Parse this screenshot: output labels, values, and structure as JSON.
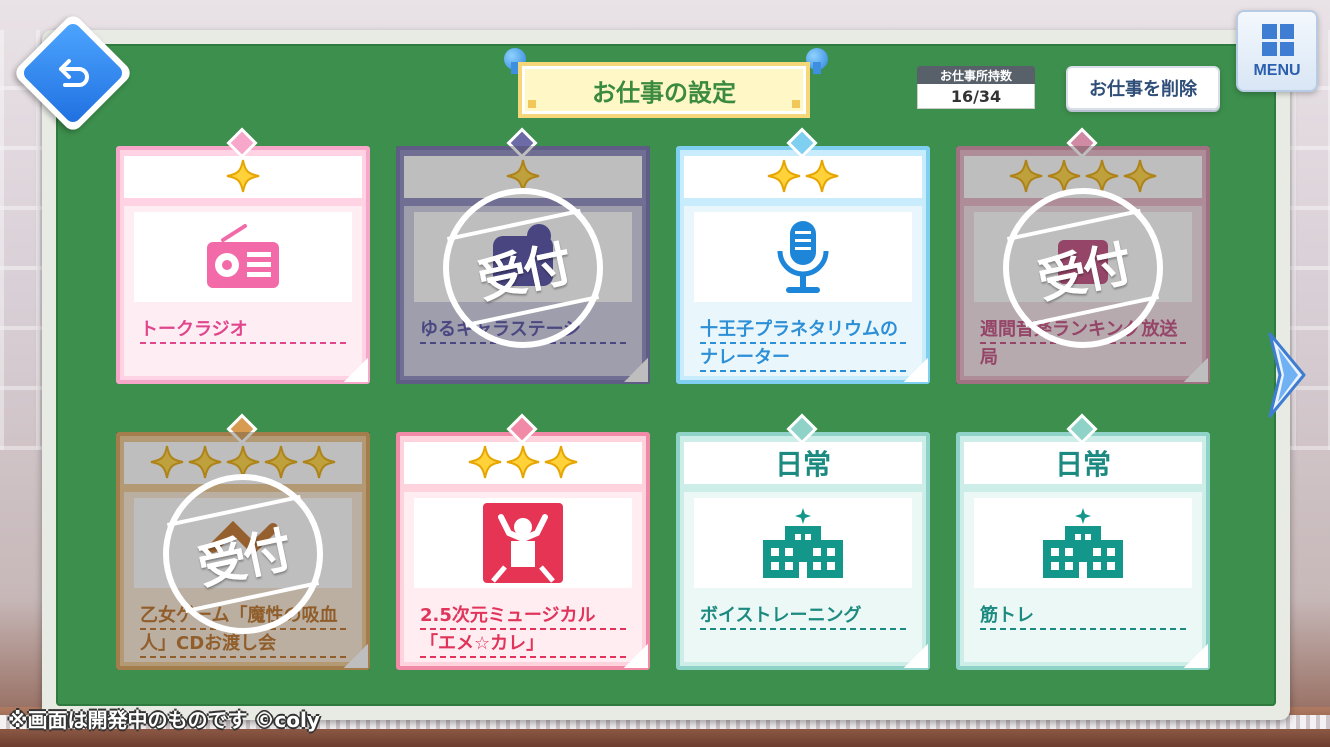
{
  "header": {
    "title": "お仕事の設定",
    "count_label": "お仕事所持数",
    "count_value": "16/34",
    "delete_label": "お仕事を削除",
    "menu_label": "MENU"
  },
  "jobs": [
    {
      "name": "トークラジオ",
      "stars": 1,
      "theme": "pink",
      "icon": "radio-icon",
      "status": ""
    },
    {
      "name": "ゆるキャラステージ",
      "stars": 1,
      "theme": "purple",
      "icon": "mascot-icon",
      "status": "受付"
    },
    {
      "name": "十王子プラネタリウムのナレーター",
      "stars": 2,
      "theme": "blue",
      "icon": "microphone-icon",
      "status": ""
    },
    {
      "name": "週間音楽ランキング放送局",
      "stars": 4,
      "theme": "rose",
      "icon": "music-icon",
      "status": "受付"
    },
    {
      "name": "乙女ゲーム「魔性の吸血人」CDお渡し会",
      "stars": 5,
      "theme": "gold",
      "icon": "handshake-icon",
      "status": "受付"
    },
    {
      "name": "2.5次元ミュージカル「エメ☆カレ」",
      "stars": 3,
      "theme": "coral",
      "icon": "stage-icon",
      "status": ""
    },
    {
      "name": "ボイストレーニング",
      "category": "日常",
      "theme": "teal",
      "icon": "school-building-icon",
      "status": ""
    },
    {
      "name": "筋トレ",
      "category": "日常",
      "theme": "teal",
      "icon": "school-building-icon",
      "status": ""
    }
  ],
  "footer": {
    "note": "※画面は開発中のものです ©coly"
  },
  "colors": {
    "board_green": "#3d8f4d",
    "pink": "#f7a7c9",
    "purple": "#6d6aa8",
    "blue": "#7fd0f0",
    "rose": "#d08aa4",
    "gold": "#d79c52",
    "coral": "#f18aa6",
    "teal": "#8fd3c8"
  }
}
